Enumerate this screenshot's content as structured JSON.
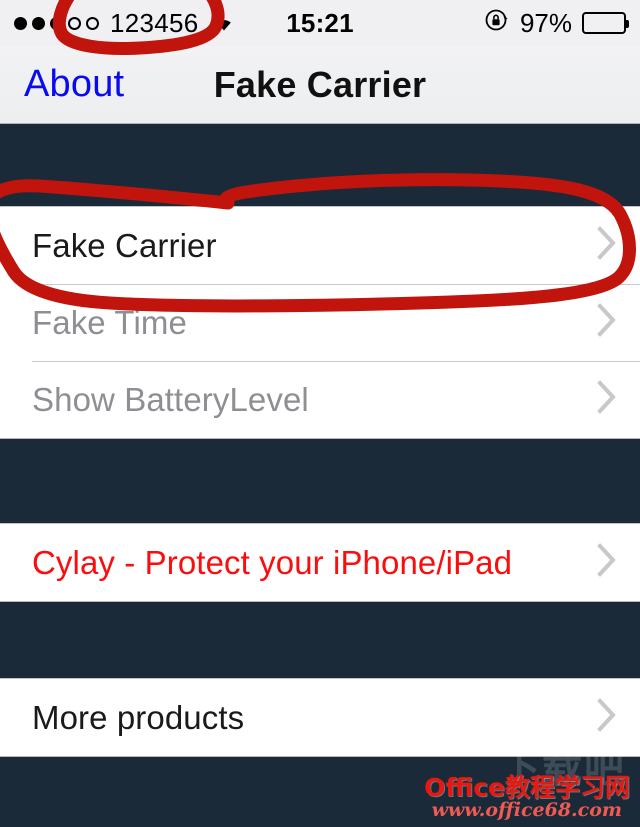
{
  "colors": {
    "annotation_red": "#c1140c",
    "section_navy": "#1a2a38",
    "row_white": "#ffffff",
    "link_blue": "#0a0af0",
    "danger_red": "#fc0d0d",
    "disabled_gray": "#8e8e93",
    "chevron_gray": "#c7c7cc",
    "navbar_gray": "#eceef0"
  },
  "status_bar": {
    "signal_dots_filled": 3,
    "signal_dots_total": 5,
    "carrier": "123456",
    "wifi_icon": "wifi-icon",
    "time": "15:21",
    "rotation_lock_icon": "rotation-lock-icon",
    "battery_percent": "97%",
    "battery_level": 97,
    "battery_icon": "battery-full-icon"
  },
  "nav_bar": {
    "back_label": "About",
    "title": "Fake Carrier"
  },
  "sections": [
    {
      "name": "settings-group",
      "rows": [
        {
          "label": "Fake Carrier",
          "style": "normal",
          "accessory": "chevron-right-icon"
        },
        {
          "label": "Fake Time",
          "style": "disabled",
          "accessory": "chevron-right-icon"
        },
        {
          "label": "Show BatteryLevel",
          "style": "disabled",
          "accessory": "chevron-right-icon"
        }
      ]
    },
    {
      "name": "promo-group",
      "rows": [
        {
          "label": "Cylay - Protect your iPhone/iPad",
          "style": "danger",
          "accessory": "chevron-right-icon"
        }
      ]
    },
    {
      "name": "more-group",
      "rows": [
        {
          "label": "More products",
          "style": "normal",
          "accessory": "chevron-right-icon"
        }
      ]
    }
  ],
  "annotations": [
    {
      "name": "carrier-field-circle",
      "target": "carrier name in status bar",
      "shape": "hand-drawn-oval"
    },
    {
      "name": "fake-carrier-row-circle",
      "target": "Fake Carrier row",
      "shape": "hand-drawn-oval"
    }
  ],
  "watermark": {
    "ghost_text": "下载吧",
    "main_text": "Office教程学习网",
    "url_text": "www.office68.com"
  }
}
